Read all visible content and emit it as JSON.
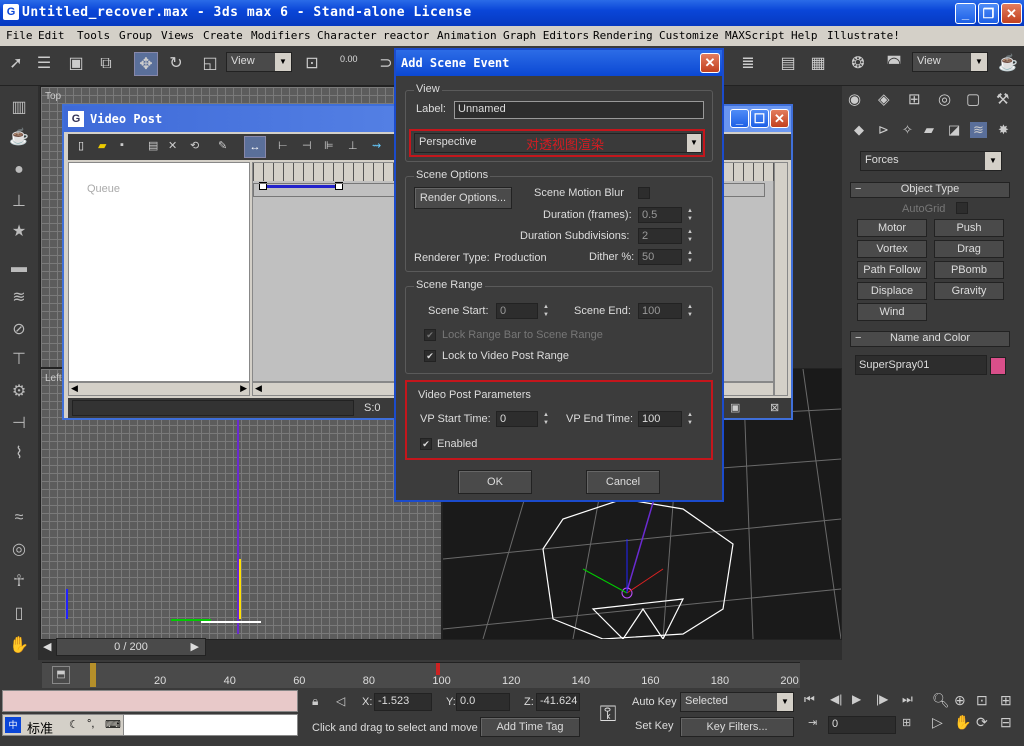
{
  "window": {
    "title": "Untitled_recover.max - 3ds max 6 - Stand-alone License"
  },
  "menu": [
    "File",
    "Edit",
    "Tools",
    "Group",
    "Views",
    "Create",
    "Modifiers",
    "Character",
    "reactor",
    "Animation",
    "Graph Editors",
    "Rendering",
    "Customize",
    "MAXScript",
    "Help",
    "Illustrate!"
  ],
  "toolbar": {
    "view_combo_left": "View",
    "view_combo_right": "View",
    "snap_value": "0.00"
  },
  "viewports": {
    "top_label": "Top",
    "left_label": "Left"
  },
  "video_post": {
    "title": "Video Post",
    "queue_label": "Queue",
    "status_s": "S:0"
  },
  "dialog": {
    "title": "Add Scene Event",
    "view_group": "View",
    "label_label": "Label:",
    "label_value": "Unnamed",
    "view_select": "Perspective",
    "annotation_view": "对透视图渲染",
    "scene_options_group": "Scene Options",
    "render_options_button": "Render Options...",
    "scene_motion_blur": "Scene Motion Blur",
    "duration_frames": "Duration (frames):",
    "duration_frames_value": "0.5",
    "duration_subdivisions": "Duration Subdivisions:",
    "duration_subdivisions_value": "2",
    "dither": "Dither %:",
    "dither_value": "50",
    "renderer_type": "Renderer Type:",
    "renderer_type_value": "Production",
    "scene_range_group": "Scene Range",
    "scene_start": "Scene Start:",
    "scene_start_value": "0",
    "scene_end": "Scene End:",
    "scene_end_value": "100",
    "lock_range_bar": "Lock Range Bar to Scene Range",
    "lock_video_post": "Lock to Video Post Range",
    "vp_params_group": "Video Post Parameters",
    "vp_start_time": "VP Start Time:",
    "vp_start_value": "0",
    "vp_end_time": "VP End Time:",
    "vp_end_value": "100",
    "enabled": "Enabled",
    "ok": "OK",
    "cancel": "Cancel"
  },
  "command_panel": {
    "category": "Forces",
    "object_type_group": "Object Type",
    "autogrid": "AutoGrid",
    "buttons": [
      "Motor",
      "Push",
      "Vortex",
      "Drag",
      "Path Follow",
      "PBomb",
      "Displace",
      "Gravity",
      "Wind"
    ],
    "name_color_group": "Name and Color",
    "object_name": "SuperSpray01",
    "color": "#d94f8a"
  },
  "timeline": {
    "frame_display": "0 / 200",
    "ticks": [
      "20",
      "40",
      "60",
      "80",
      "100",
      "120",
      "140",
      "160",
      "180",
      "200"
    ]
  },
  "status": {
    "x_label": "X:",
    "x_value": "-1.523",
    "y_label": "Y:",
    "y_value": "0.0",
    "z_label": "Z:",
    "z_value": "-41.624",
    "auto_key": "Auto Key",
    "selected": "Selected",
    "set_key": "Set Key",
    "key_filters": "Key Filters...",
    "frame_field": "0",
    "prompt": "Click and drag to select and move",
    "add_time_tag": "Add Time Tag",
    "ime_label": "标准"
  }
}
